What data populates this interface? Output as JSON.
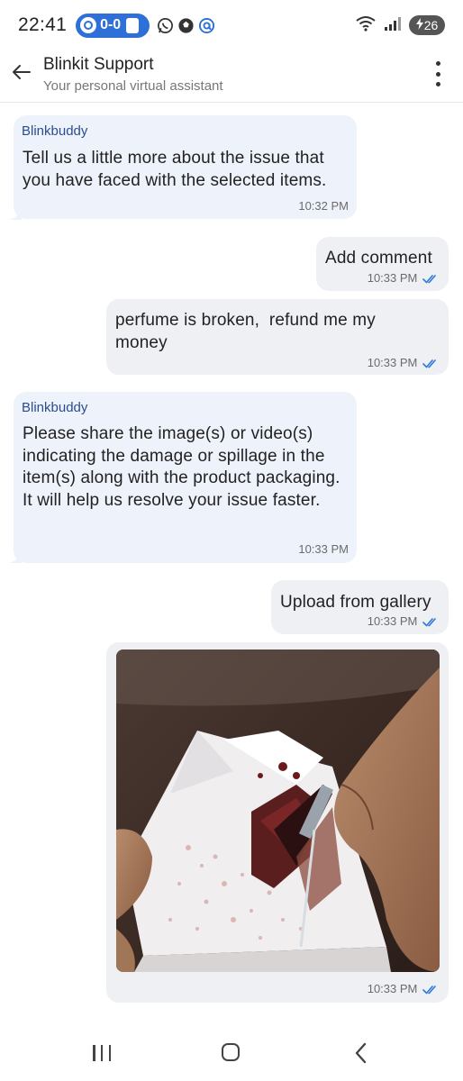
{
  "status_bar": {
    "time": "22:41",
    "pill_text": "0-0",
    "battery": "26",
    "accent": "#2f6fd8"
  },
  "header": {
    "title": "Blinkit Support",
    "subtitle": "Your personal virtual assistant"
  },
  "messages": [
    {
      "direction": "incoming",
      "sender": "Blinkbuddy",
      "text": "Tell us a little more about the issue that you have faced with the selected items.",
      "time": "10:32 PM"
    },
    {
      "direction": "outgoing",
      "text": "Add comment",
      "time": "10:33 PM",
      "read": true
    },
    {
      "direction": "outgoing",
      "text": "perfume is broken,  refund me my money",
      "time": "10:33 PM",
      "read": true
    },
    {
      "direction": "incoming",
      "sender": "Blinkbuddy",
      "text": "Please share the image(s) or video(s) indicating the damage or spillage in the item(s) along with the product packaging. It will help us resolve your issue faster.",
      "time": "10:33 PM"
    },
    {
      "direction": "outgoing",
      "text": "Upload from gallery",
      "time": "10:33 PM",
      "read": true
    },
    {
      "direction": "outgoing",
      "type": "image",
      "time": "10:33 PM",
      "read": true
    }
  ],
  "colors": {
    "incoming_bubble": "#eef2fb",
    "outgoing_bubble": "#eef0f4",
    "sender_name": "#2a4d8f",
    "read_tick": "#2f78d6"
  }
}
